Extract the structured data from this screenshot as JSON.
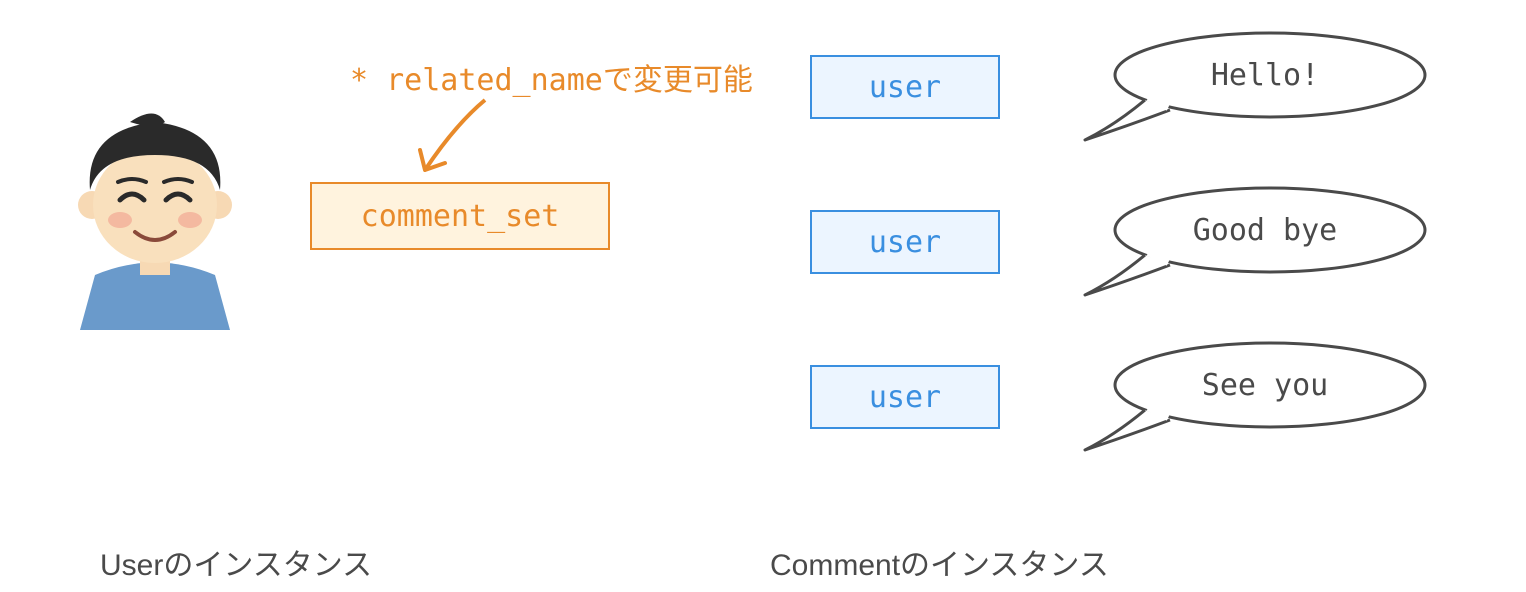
{
  "colors": {
    "orange": "#e88a2a",
    "orange_fill": "#fff3de",
    "blue": "#3a8fe0",
    "blue_fill": "#ecf5ff",
    "text": "#4a4a4a"
  },
  "user_side": {
    "note": "* related_nameで変更可能",
    "box_label": "comment_set",
    "caption": "Userのインスタンス"
  },
  "comment_side": {
    "caption": "Commentのインスタンス",
    "rows": [
      {
        "field": "user",
        "message": "Hello!"
      },
      {
        "field": "user",
        "message": "Good bye"
      },
      {
        "field": "user",
        "message": "See you"
      }
    ]
  }
}
